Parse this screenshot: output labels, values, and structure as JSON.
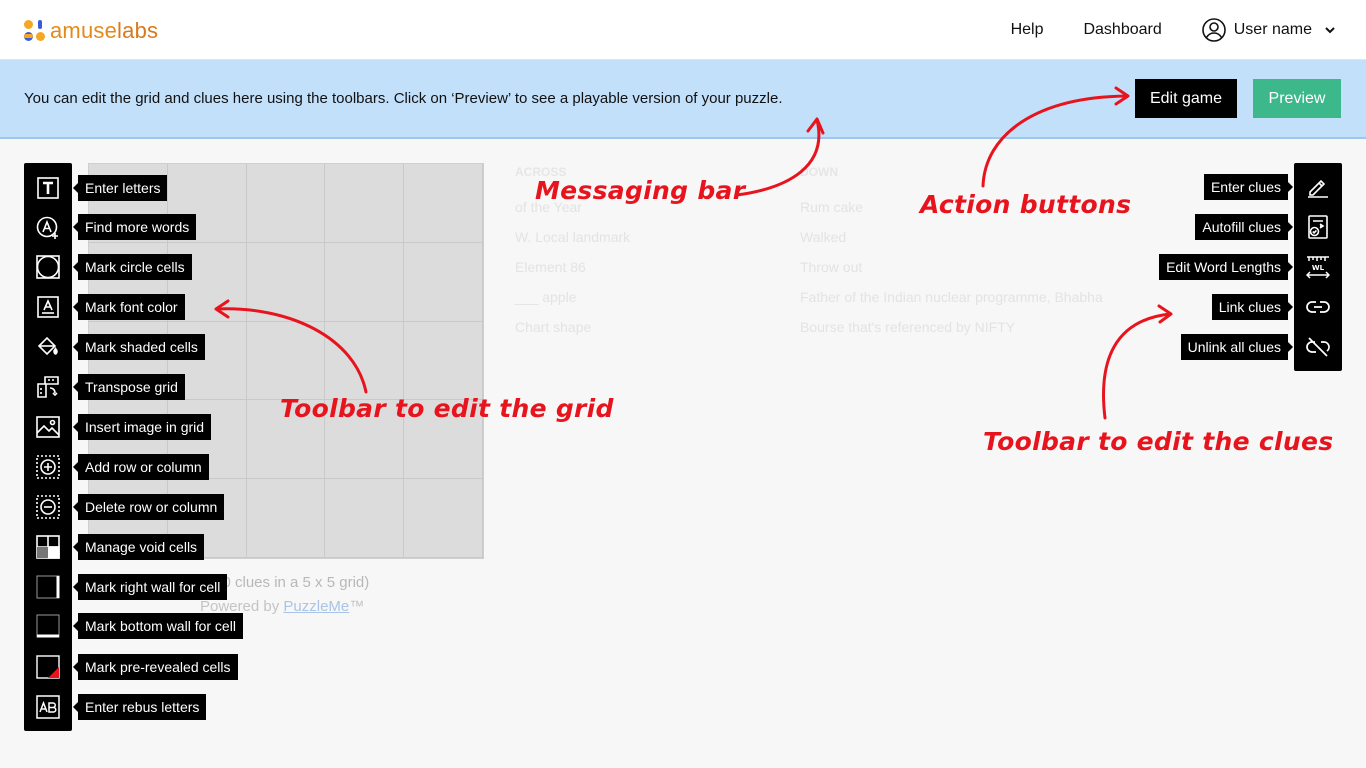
{
  "header": {
    "logo_text_a": "amuse",
    "logo_text_b": "labs",
    "nav": {
      "help": "Help",
      "dashboard": "Dashboard",
      "user": "User name"
    }
  },
  "message_bar": {
    "text": "You can edit the grid and clues here using the toolbars. Click on ‘Preview’ to see a playable version of your puzzle.",
    "edit_game": "Edit game",
    "preview": "Preview"
  },
  "grid": {
    "rows": 5,
    "cols": 5,
    "caption": "rd (0 clues in a 5 x 5 grid)",
    "powered_prefix": "Powered by ",
    "powered_link": "PuzzleMe",
    "powered_suffix": "™"
  },
  "clues_across": {
    "header": "ACROSS",
    "items": [
      "of the Year",
      "W. Local landmark",
      "Element 86",
      "___ apple",
      "Chart shape"
    ]
  },
  "clues_down": {
    "header": "DOWN",
    "items": [
      "Rum cake",
      "Walked",
      "Throw out",
      "Father of the Indian nuclear programme, Bhabha",
      "Bourse that's referenced by NIFTY"
    ]
  },
  "left_toolbar": [
    {
      "label": "Enter letters",
      "icon": "text-icon"
    },
    {
      "label": "Find more words",
      "icon": "find-words-icon"
    },
    {
      "label": "Mark circle cells",
      "icon": "circle-icon"
    },
    {
      "label": "Mark font color",
      "icon": "font-color-icon"
    },
    {
      "label": "Mark shaded cells",
      "icon": "paint-bucket-icon"
    },
    {
      "label": "Transpose grid",
      "icon": "transpose-icon"
    },
    {
      "label": "Insert image in grid",
      "icon": "image-icon"
    },
    {
      "label": "Add row or column",
      "icon": "add-row-icon"
    },
    {
      "label": "Delete row or column",
      "icon": "delete-row-icon"
    },
    {
      "label": "Manage void cells",
      "icon": "void-cells-icon"
    },
    {
      "label": "Mark right wall for cell",
      "icon": "right-wall-icon"
    },
    {
      "label": "Mark bottom wall for cell",
      "icon": "bottom-wall-icon"
    },
    {
      "label": "Mark pre-revealed cells",
      "icon": "pre-revealed-icon"
    },
    {
      "label": "Enter rebus letters",
      "icon": "rebus-icon"
    }
  ],
  "right_toolbar": [
    {
      "label": "Enter clues",
      "icon": "pencil-icon"
    },
    {
      "label": "Autofill clues",
      "icon": "autofill-icon"
    },
    {
      "label": "Edit Word Lengths",
      "icon": "word-length-icon"
    },
    {
      "label": "Link clues",
      "icon": "link-icon"
    },
    {
      "label": "Unlink all clues",
      "icon": "unlink-icon"
    }
  ],
  "annotations": {
    "messaging_bar": "Messaging bar",
    "action_buttons": "Action buttons",
    "grid_toolbar": "Toolbar to edit the grid",
    "clue_toolbar": "Toolbar to edit the clues"
  },
  "colors": {
    "message_bar_bg": "#c3e0fb",
    "preview_button": "#3cb88a",
    "annotation_red": "#e8141d",
    "logo_orange": "#e38a1c"
  }
}
